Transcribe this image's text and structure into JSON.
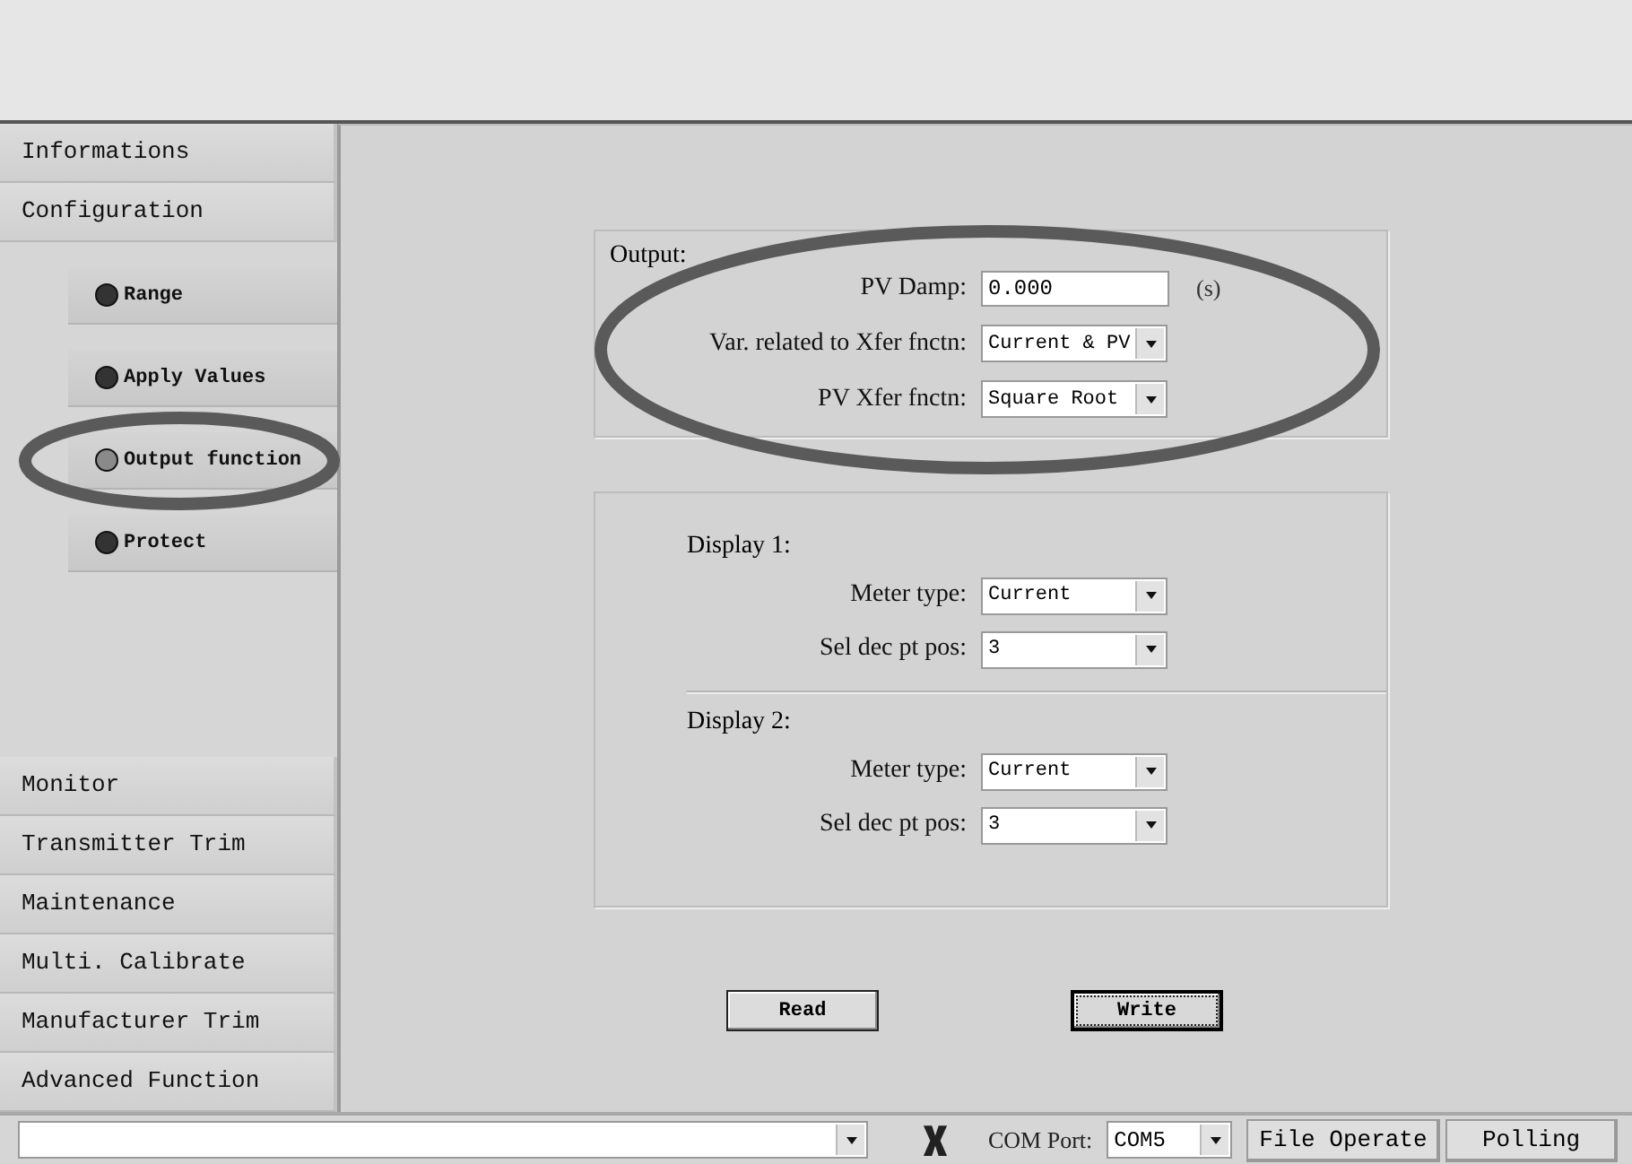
{
  "sidebar": {
    "items": [
      {
        "label": "Informations"
      },
      {
        "label": "Configuration",
        "children": [
          {
            "label": "Range",
            "selected": false,
            "circled": false
          },
          {
            "label": "Apply Values",
            "selected": false,
            "circled": false
          },
          {
            "label": "Output function",
            "selected": true,
            "circled": true
          },
          {
            "label": "Protect",
            "selected": false,
            "circled": false
          }
        ]
      },
      {
        "label": "Monitor"
      },
      {
        "label": "Transmitter Trim"
      },
      {
        "label": "Maintenance"
      },
      {
        "label": "Multi. Calibrate"
      },
      {
        "label": "Manufacturer Trim"
      },
      {
        "label": "Advanced Function"
      }
    ]
  },
  "output_group": {
    "title": "Output:",
    "circled": true,
    "fields": [
      {
        "kind": "text",
        "label": "PV Damp:",
        "value": "0.000",
        "unit": "(s)"
      },
      {
        "kind": "select",
        "label": "Var. related to Xfer fnctn:",
        "value": "Current & PV"
      },
      {
        "kind": "select",
        "label": "PV Xfer fnctn:",
        "value": "Square Root"
      }
    ]
  },
  "display_group": {
    "sections": [
      {
        "title": "Display 1:",
        "fields": [
          {
            "kind": "select",
            "label": "Meter type:",
            "value": "Current"
          },
          {
            "kind": "select",
            "label": "Sel dec pt pos:",
            "value": "3"
          }
        ]
      },
      {
        "title": "Display 2:",
        "fields": [
          {
            "kind": "select",
            "label": "Meter type:",
            "value": "Current"
          },
          {
            "kind": "select",
            "label": "Sel dec pt pos:",
            "value": "3"
          }
        ]
      }
    ]
  },
  "buttons": [
    {
      "label": "Read",
      "focused": false
    },
    {
      "label": "Write",
      "focused": true
    }
  ],
  "status_bar": {
    "com_port": {
      "label": "COM Port:",
      "value": "COM5"
    },
    "buttons": [
      "File Operate",
      "Polling"
    ]
  }
}
